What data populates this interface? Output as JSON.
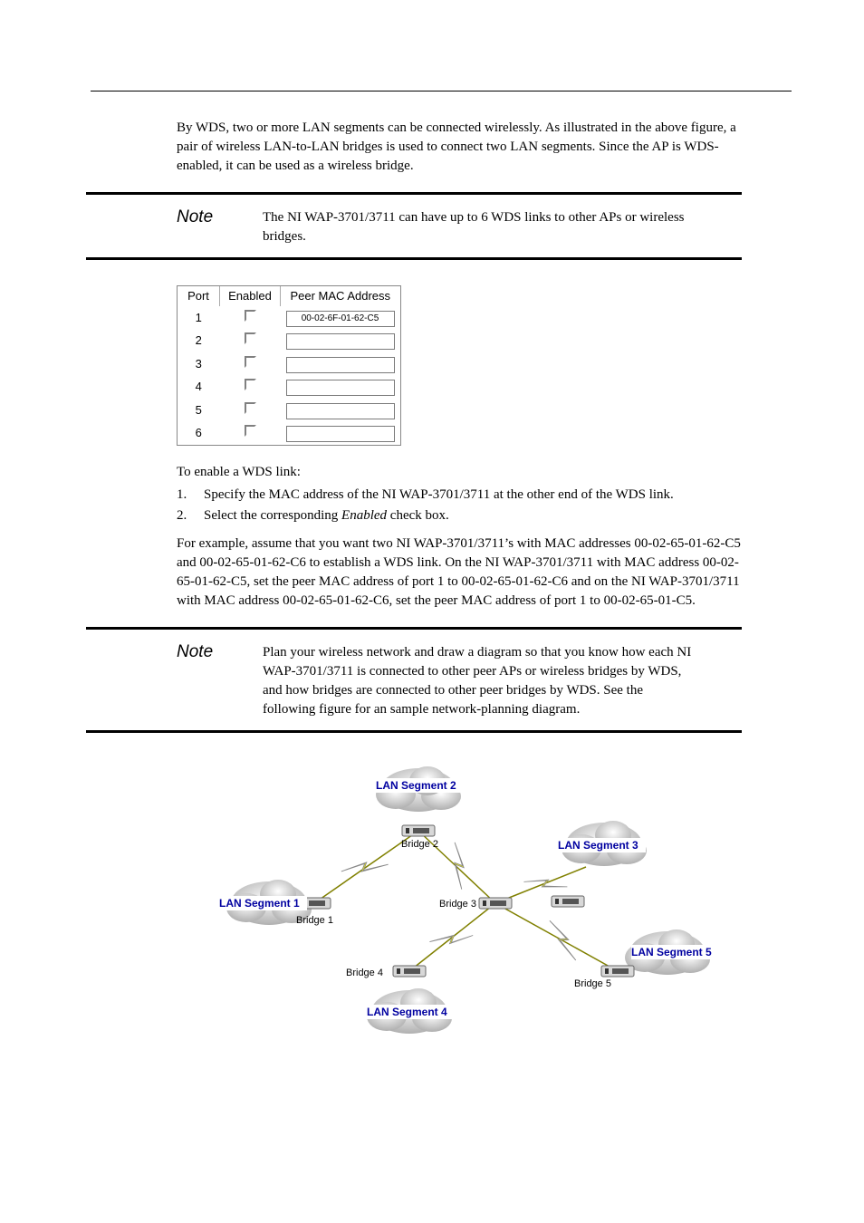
{
  "intro": "By WDS, two or more LAN segments can be connected wirelessly. As illustrated in the above figure, a pair of wireless LAN-to-LAN bridges is used to connect two LAN segments. Since the AP is WDS-enabled, it can be used as a wireless bridge.",
  "note1": {
    "label": "Note",
    "text": "The NI WAP-3701/3711 can have up to 6 WDS links to other APs or wireless bridges."
  },
  "wds_table": {
    "headers": {
      "port": "Port",
      "enabled": "Enabled",
      "mac": "Peer MAC Address"
    },
    "rows": [
      {
        "port": "1",
        "mac": "00-02-6F-01-62-C5"
      },
      {
        "port": "2",
        "mac": ""
      },
      {
        "port": "3",
        "mac": ""
      },
      {
        "port": "4",
        "mac": ""
      },
      {
        "port": "5",
        "mac": ""
      },
      {
        "port": "6",
        "mac": ""
      }
    ]
  },
  "enable_heading": "To enable a WDS link:",
  "steps": {
    "s1_num": "1.",
    "s1_txt": "Specify the MAC address of the NI WAP-3701/3711 at the other end of the WDS link.",
    "s2_num": "2.",
    "s2_a": "Select the corresponding ",
    "s2_b": "Enabled",
    "s2_c": " check box."
  },
  "example": "For example, assume that you want two NI WAP-3701/3711’s with MAC addresses 00-02-65-01-62-C5 and 00-02-65-01-62-C6 to establish a WDS link. On the NI WAP-3701/3711 with MAC address 00-02-65-01-62-C5, set the peer MAC address of port 1 to 00-02-65-01-62-C6 and on the NI WAP-3701/3711 with MAC address 00-02-65-01-62-C6, set the peer MAC address of port 1 to 00-02-65-01-C5.",
  "note2": {
    "label": "Note",
    "text": "Plan your wireless network and draw a diagram so that you know how each NI WAP-3701/3711 is connected to other peer APs or wireless bridges by WDS, and how bridges are connected to other peer bridges by WDS. See the following figure for an sample network-planning diagram."
  },
  "diagram": {
    "seg1": "LAN Segment 1",
    "seg2": "LAN Segment 2",
    "seg3": "LAN Segment 3",
    "seg4": "LAN Segment 4",
    "seg5": "LAN Segment 5",
    "b1": "Bridge 1",
    "b2": "Bridge 2",
    "b3": "Bridge 3",
    "b4": "Bridge 4",
    "b5": "Bridge 5"
  }
}
